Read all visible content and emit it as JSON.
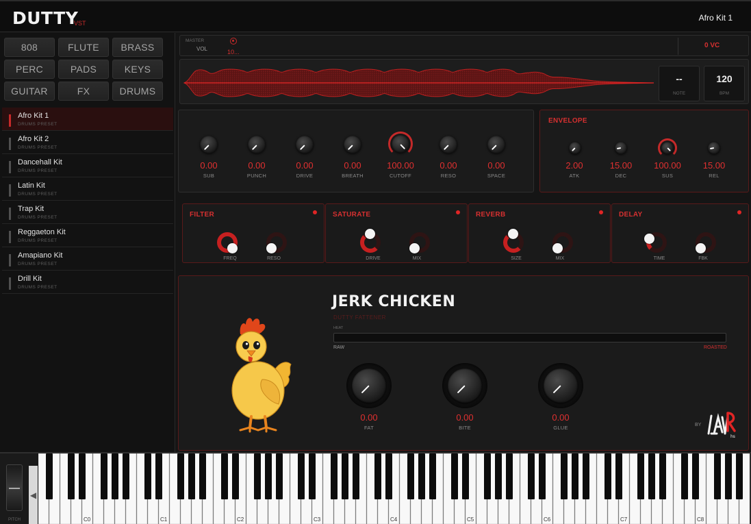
{
  "header": {
    "logo": "DUTTY",
    "logo_sub": "VST",
    "preset": "Afro Kit 1"
  },
  "categories": [
    "808",
    "FLUTE",
    "BRASS",
    "PERC",
    "PADS",
    "KEYS",
    "GUITAR",
    "FX",
    "DRUMS"
  ],
  "presets": [
    {
      "name": "Afro Kit 1",
      "type": "DRUMS PRESET",
      "active": true
    },
    {
      "name": "Afro Kit 2",
      "type": "DRUMS PRESET"
    },
    {
      "name": "Dancehall Kit",
      "type": "DRUMS PRESET"
    },
    {
      "name": "Latin Kit",
      "type": "DRUMS PRESET"
    },
    {
      "name": "Trap Kit",
      "type": "DRUMS PRESET"
    },
    {
      "name": "Reggaeton Kit",
      "type": "DRUMS PRESET"
    },
    {
      "name": "Amapiano Kit",
      "type": "DRUMS PRESET"
    },
    {
      "name": "Drill Kit",
      "type": "DRUMS PRESET"
    }
  ],
  "master": {
    "label": "MASTER",
    "vol_label": "VOL",
    "vol_value": "10...",
    "voices": "0 VC"
  },
  "display": {
    "note_value": "--",
    "note_label": "NOTE",
    "bpm_value": "120",
    "bpm_label": "BPM"
  },
  "tone_knobs": [
    {
      "label": "SUB",
      "value": "0.00"
    },
    {
      "label": "PUNCH",
      "value": "0.00"
    },
    {
      "label": "DRIVE",
      "value": "0.00"
    },
    {
      "label": "BREATH",
      "value": "0.00"
    },
    {
      "label": "CUTOFF",
      "value": "100.00"
    },
    {
      "label": "RESO",
      "value": "0.00"
    },
    {
      "label": "SPACE",
      "value": "0.00"
    }
  ],
  "envelope": {
    "title": "ENVELOPE",
    "knobs": [
      {
        "label": "ATK",
        "value": "2.00"
      },
      {
        "label": "DEC",
        "value": "15.00"
      },
      {
        "label": "SUS",
        "value": "100.00"
      },
      {
        "label": "REL",
        "value": "15.00"
      }
    ]
  },
  "effects": [
    {
      "title": "FILTER",
      "params": [
        "FREQ",
        "RESO"
      ]
    },
    {
      "title": "SATURATE",
      "params": [
        "DRIVE",
        "MIX"
      ]
    },
    {
      "title": "REVERB",
      "params": [
        "SIZE",
        "MIX"
      ]
    },
    {
      "title": "DELAY",
      "params": [
        "TIME",
        "FBK"
      ]
    }
  ],
  "jerk": {
    "title": "JERK CHICKEN",
    "subtitle": "DUTTY FATTENER",
    "heat_label": "HEAT",
    "raw_label": "RAW",
    "roasted_label": "ROASTED",
    "knobs": [
      {
        "label": "FAT",
        "value": "0.00"
      },
      {
        "label": "BITE",
        "value": "0.00"
      },
      {
        "label": "GLUE",
        "value": "0.00"
      }
    ],
    "by_label": "BY",
    "brand_logo": "LAYR"
  },
  "keyboard": {
    "pitch_label": "PITCH",
    "octave_labels": [
      "C0",
      "C1",
      "C2",
      "C3",
      "C4",
      "C5",
      "C6",
      "C7",
      "C8"
    ]
  },
  "colors": {
    "accent": "#d63030",
    "panel": "#1b1b1b",
    "background": "#151515"
  }
}
